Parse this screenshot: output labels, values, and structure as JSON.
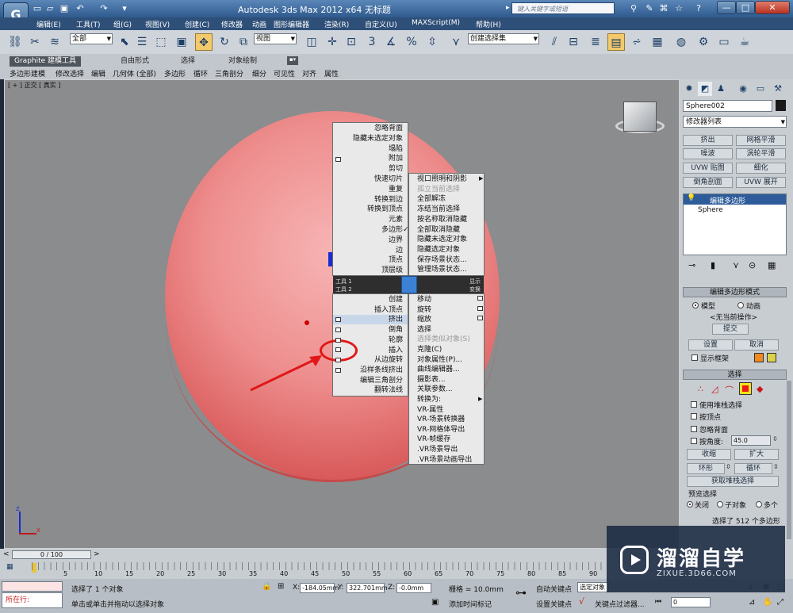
{
  "window": {
    "app_logo": "G",
    "title": "Autodesk 3ds Max  2012 x64    无标题",
    "search_placeholder": "键入关键字或短语",
    "buttons": {
      "minimize": "—",
      "maximize": "□",
      "close": "✕"
    }
  },
  "menubar": [
    "编辑(E)",
    "工具(T)",
    "组(G)",
    "视图(V)",
    "创建(C)",
    "修改器",
    "动画",
    "图形编辑器",
    "渲染(R)",
    "自定义(U)",
    "MAXScript(M)",
    "帮助(H)"
  ],
  "toolbar": {
    "selection_filter": "全部",
    "reference_coord": "视图",
    "named_selection": "创建选择集",
    "snap_labels": [
      "3",
      "%"
    ]
  },
  "ribbon": {
    "tabs": [
      "Graphite 建模工具",
      "自由形式",
      "选择",
      "对象绘制"
    ],
    "active_tab": 0,
    "subtabs": [
      "多边形建模",
      "修改选择",
      "编辑",
      "几何体 (全部)",
      "多边形",
      "循环",
      "三角剖分",
      "细分",
      "可见性",
      "对齐",
      "属性"
    ]
  },
  "viewport": {
    "label": "[ + ] 正交 [ 真实 ]",
    "object_color": "#ee8e8e",
    "axis": {
      "x": "X",
      "y": "Y",
      "z": "Z"
    }
  },
  "quad_menu": {
    "top_left": [
      "忽略背面",
      "隐藏未选定对象",
      "塌陷",
      "附加",
      "剪切",
      "快速切片",
      "重复",
      "转换到边",
      "转换到顶点",
      "元素",
      "多边形",
      "边界",
      "边",
      "顶点",
      "顶层级"
    ],
    "checked_item": "多边形",
    "top_right": [
      "视口照明和阴影",
      "孤立当前选择",
      "全部解冻",
      "冻结当前选择",
      "按名称取消隐藏",
      "全部取消隐藏",
      "隐藏未选定对象",
      "隐藏选定对象",
      "保存场景状态...",
      "管理场景状态..."
    ],
    "disabled_items": [
      "孤立当前选择",
      "选择类似对象(S)"
    ],
    "header_left": [
      "工具 1",
      "工具 2"
    ],
    "header_right": [
      "显示",
      "变换"
    ],
    "bottom_left": [
      "创建",
      "插入顶点",
      "挤出",
      "倒角",
      "轮廓",
      "插入",
      "从边旋转",
      "沿样条线挤出",
      "编辑三角剖分",
      "翻转法线"
    ],
    "highlighted_item": "挤出",
    "bottom_right": [
      "移动",
      "旋转",
      "缩放",
      "选择",
      "选择类似对象(S)",
      "克隆(C)",
      "对象属性(P)...",
      "曲线编辑器...",
      "摄影表...",
      "关联参数...",
      "转换为:",
      "VR-属性",
      "VR-场景转换器",
      "VR-网格体导出",
      "VR-帧缓存",
      ".VR场景导出",
      ".VR场景动画导出"
    ]
  },
  "command_panel": {
    "object_name": "Sphere002",
    "object_color": "#1a1a1a",
    "modifier_list": "修改器列表",
    "modifier_buttons": [
      "挤出",
      "网格平滑",
      "噪波",
      "涡轮平滑",
      "UVW 贴图",
      "细化",
      "倒角剖面",
      "UVW 展开"
    ],
    "stack": [
      "编辑多边形",
      "Sphere"
    ],
    "rollouts": {
      "edit_poly_mode": {
        "title": "编辑多边形模式",
        "model": "模型",
        "animate": "动画",
        "current_op": "<无当前操作>",
        "commit": "提交",
        "settings": "设置",
        "cancel": "取消",
        "show_cage": "显示框架",
        "cage_colors": [
          "#f08a1e",
          "#d9d24a"
        ]
      },
      "selection": {
        "title": "选择",
        "active_color": "#e81c1c",
        "options": [
          "使用堆栈选择",
          "按顶点",
          "忽略背面",
          "按角度:"
        ],
        "angle_value": "45.0",
        "shrink": "收缩",
        "grow": "扩大",
        "ring": "环形",
        "loop": "循环",
        "get_stack": "获取堆栈选择",
        "preview_title": "预览选择",
        "preview_options": [
          "关闭",
          "子对象",
          "多个"
        ],
        "status": "选择了 512 个多边形"
      }
    }
  },
  "timeline": {
    "frame": "0 / 100",
    "ticks": [
      "5",
      "10",
      "15",
      "20",
      "25",
      "30",
      "35",
      "40",
      "45",
      "50",
      "55",
      "60",
      "65",
      "70",
      "75",
      "80",
      "85",
      "90"
    ]
  },
  "status": {
    "maxscript_label": "所在行: ",
    "selected_text": "选择了 1 个对象",
    "hint": "单击或单击并拖动以选择对象",
    "x_label": "X:",
    "x_value": "-184.05mm",
    "y_label": "Y:",
    "y_value": "322.701mm",
    "z_label": "Z:",
    "z_value": "-0.0mm",
    "grid": "栅格 = 10.0mm",
    "auto_key": "自动关键点",
    "set_key": "设置关键点",
    "selection_mode": "选定对象",
    "key_filters": "关键点过滤器...",
    "add_time_tag": "添加时间标记",
    "frame_field": "0"
  },
  "watermark": {
    "brand": "溜溜自学",
    "url": "ZIXUE.3D66.COM"
  },
  "colors": {
    "annotation": "#e01818",
    "selection_blue": "#2e5c9a",
    "title_bar": "#3f6a99"
  }
}
